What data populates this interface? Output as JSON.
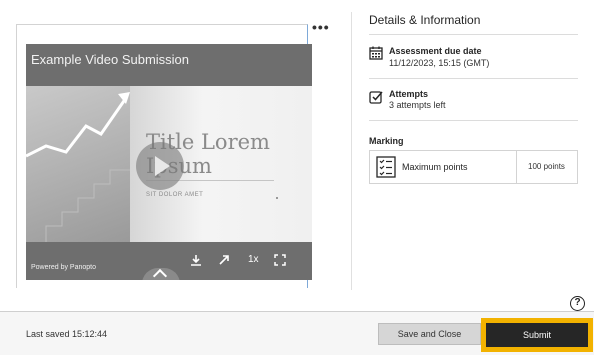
{
  "video": {
    "title": "Example Video Submission",
    "thumbnail_title": "Title Lorem Ipsum",
    "thumbnail_subtitle": "SIT DOLOR AMET",
    "powered_by": "Powered by Panopto",
    "speed": "1x"
  },
  "details": {
    "heading": "Details & Information",
    "due": {
      "label": "Assessment due date",
      "value": "11/12/2023, 15:15 (GMT)",
      "icon": "calendar-icon"
    },
    "attempts": {
      "label": "Attempts",
      "value": "3 attempts left",
      "icon": "checkbox-icon"
    },
    "marking": {
      "label": "Marking",
      "name": "Maximum points",
      "points": "100 points",
      "icon": "rubric-icon"
    }
  },
  "footer": {
    "last_saved": "Last saved 15:12:44",
    "save_close_label": "Save and Close",
    "submit_label": "Submit"
  },
  "help_label": "?",
  "more_label": "•••",
  "colors": {
    "highlight": "#f2b200",
    "submit_bg": "#262626"
  }
}
